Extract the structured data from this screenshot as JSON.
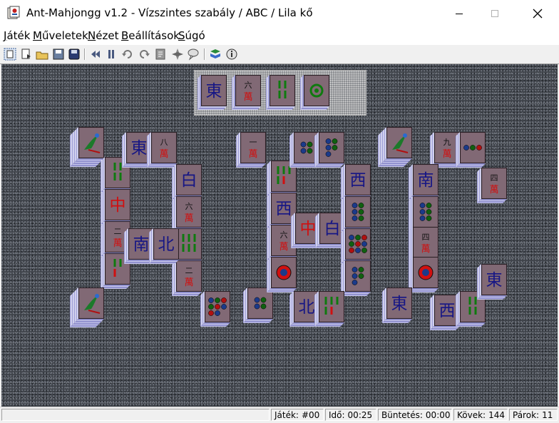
{
  "window": {
    "title": "Ant-Mahjongg v1.2 - Vízszintes szabály / ABC / Lila kő"
  },
  "menu": [
    {
      "key": "J",
      "rest": "áték"
    },
    {
      "key": "M",
      "rest": "űveletek"
    },
    {
      "key": "N",
      "rest": "ézet"
    },
    {
      "key": "B",
      "rest": "eállítások"
    },
    {
      "key": "S",
      "rest": "úgó"
    }
  ],
  "toolbar": [
    "new-game-icon",
    "open-game-icon",
    "load-icon",
    "save-icon",
    "save-as-icon",
    "rewind-icon",
    "pause-icon",
    "undo-icon",
    "redo-icon",
    "hint-icon",
    "shuffle-icon",
    "chat-icon",
    "help-book-icon",
    "info-icon"
  ],
  "status": {
    "game_label": "Játék:",
    "game_value": "#00",
    "time_label": "Idő:",
    "time_value": "00:25",
    "penalty_label": "Büntetés:",
    "penalty_value": "00:00",
    "stones_label": "Kövek:",
    "stones_value": "144",
    "pairs_label": "Párok:",
    "pairs_value": "11"
  },
  "tray": [
    {
      "kind": "char",
      "ch": "東"
    },
    {
      "kind": "wan",
      "n": "六"
    },
    {
      "kind": "bamboo",
      "n": 4
    },
    {
      "kind": "flower"
    }
  ],
  "colors": {
    "tile_face": "#7d6570",
    "tile_side": "#9f9fd8",
    "wind": "#161685",
    "dragon_red": "#d01010",
    "dragon_green": "#0f7a0f"
  }
}
